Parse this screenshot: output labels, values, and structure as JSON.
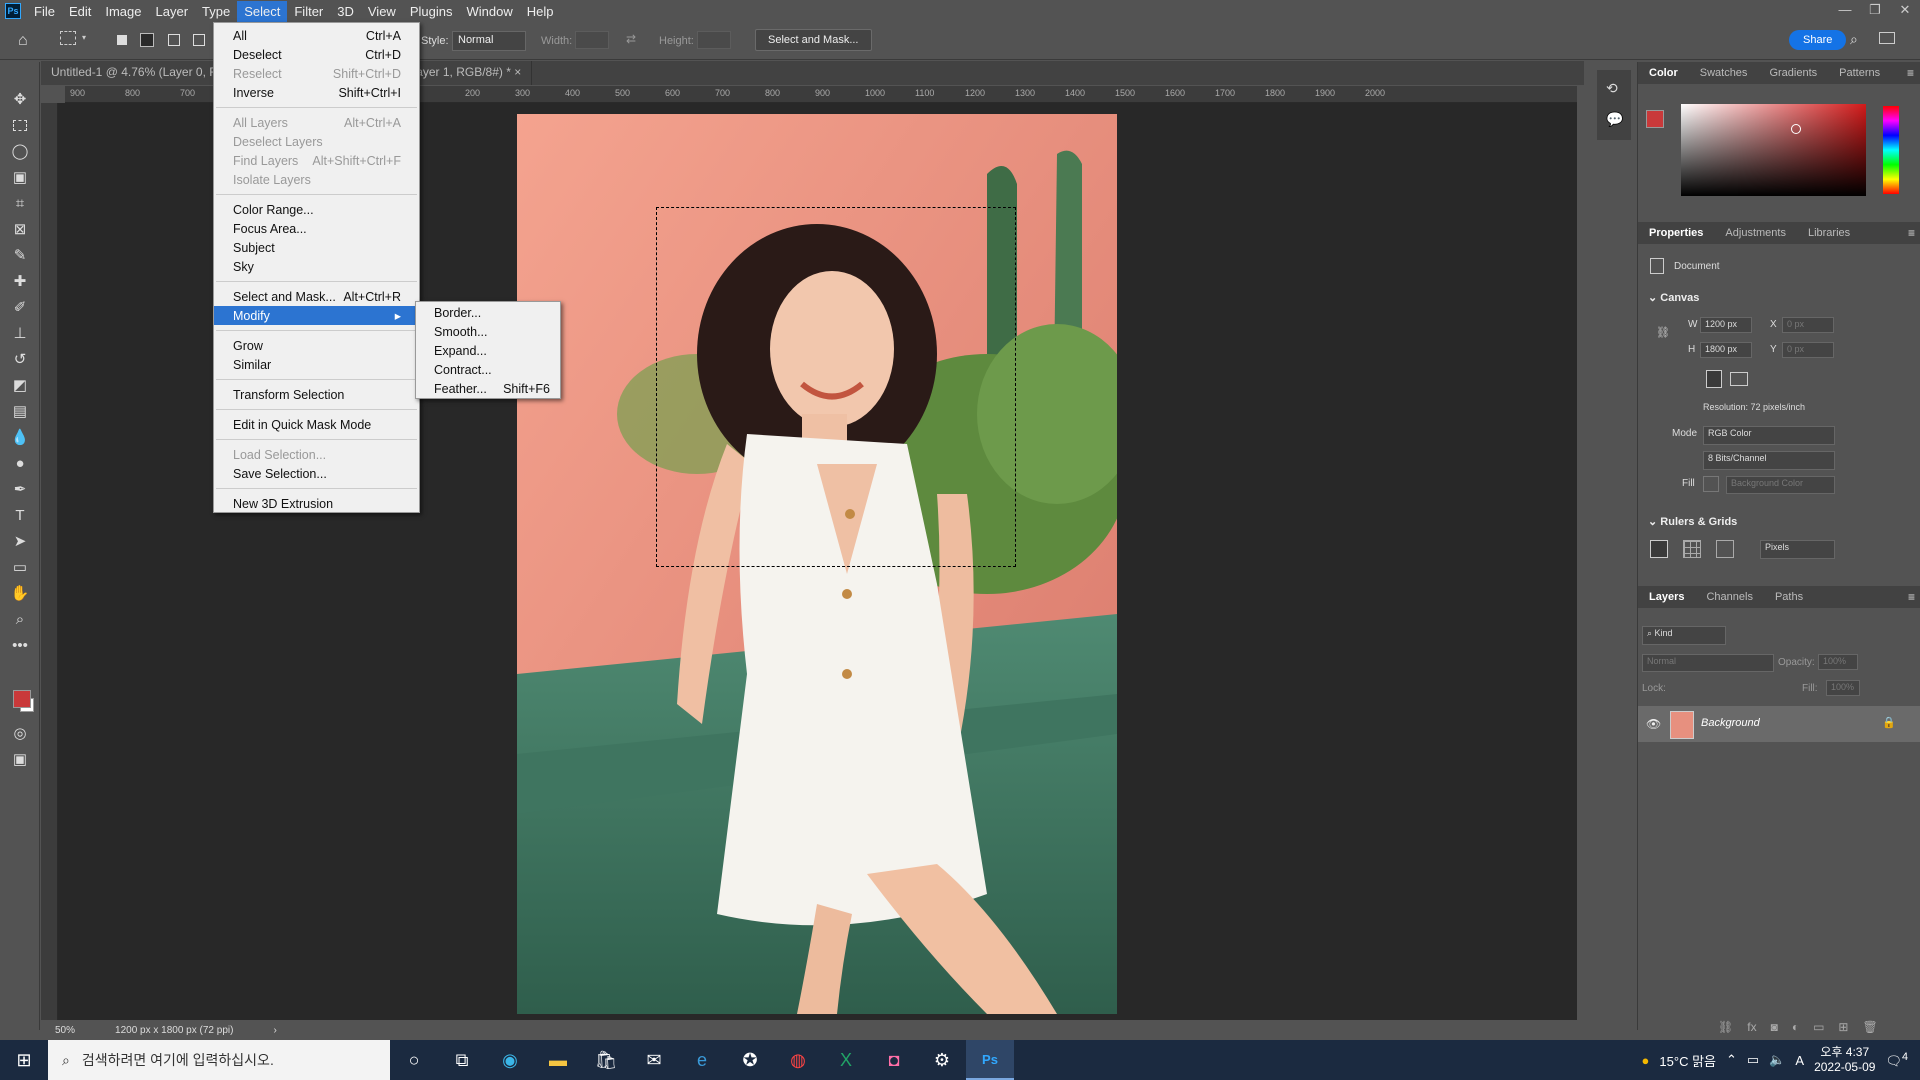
{
  "menubar": {
    "items": [
      "File",
      "Edit",
      "Image",
      "Layer",
      "Type",
      "Select",
      "Filter",
      "3D",
      "View",
      "Plugins",
      "Window",
      "Help"
    ],
    "active": "Select"
  },
  "options": {
    "style_label": "Style:",
    "style_value": "Normal",
    "width_label": "Width:",
    "height_label": "Height:",
    "select_mask_button": "Select and Mask...",
    "share_button": "Share"
  },
  "tabs": [
    {
      "label": "Untitled-1 @ 4.76% (Layer 0, R",
      "active": false
    },
    {
      "label": "/8#)",
      "active": true
    },
    {
      "label": "Untitled-2 @ 100% (Layer 1, RGB/8#) *",
      "active": false
    }
  ],
  "ruler": {
    "ticks": [
      "900",
      "800",
      "700",
      "200",
      "300",
      "400",
      "500",
      "600",
      "700",
      "800",
      "900",
      "1000",
      "1100",
      "1200",
      "1300",
      "1400",
      "1500",
      "1600",
      "1700",
      "1800",
      "1900",
      "2000"
    ]
  },
  "select_menu": {
    "groups": [
      [
        {
          "label": "All",
          "shortcut": "Ctrl+A",
          "disabled": false
        },
        {
          "label": "Deselect",
          "shortcut": "Ctrl+D",
          "disabled": false
        },
        {
          "label": "Reselect",
          "shortcut": "Shift+Ctrl+D",
          "disabled": true
        },
        {
          "label": "Inverse",
          "shortcut": "Shift+Ctrl+I",
          "disabled": false
        }
      ],
      [
        {
          "label": "All Layers",
          "shortcut": "Alt+Ctrl+A",
          "disabled": true
        },
        {
          "label": "Deselect Layers",
          "shortcut": "",
          "disabled": true
        },
        {
          "label": "Find Layers",
          "shortcut": "Alt+Shift+Ctrl+F",
          "disabled": true
        },
        {
          "label": "Isolate Layers",
          "shortcut": "",
          "disabled": true
        }
      ],
      [
        {
          "label": "Color Range...",
          "shortcut": "",
          "disabled": false
        },
        {
          "label": "Focus Area...",
          "shortcut": "",
          "disabled": false
        },
        {
          "label": "Subject",
          "shortcut": "",
          "disabled": false
        },
        {
          "label": "Sky",
          "shortcut": "",
          "disabled": false
        }
      ],
      [
        {
          "label": "Select and Mask...",
          "shortcut": "Alt+Ctrl+R",
          "disabled": false
        },
        {
          "label": "Modify",
          "shortcut": "",
          "disabled": false,
          "highlighted": true,
          "submenu": true
        }
      ],
      [
        {
          "label": "Grow",
          "shortcut": "",
          "disabled": false
        },
        {
          "label": "Similar",
          "shortcut": "",
          "disabled": false
        }
      ],
      [
        {
          "label": "Transform Selection",
          "shortcut": "",
          "disabled": false
        }
      ],
      [
        {
          "label": "Edit in Quick Mask Mode",
          "shortcut": "",
          "disabled": false
        }
      ],
      [
        {
          "label": "Load Selection...",
          "shortcut": "",
          "disabled": true
        },
        {
          "label": "Save Selection...",
          "shortcut": "",
          "disabled": false
        }
      ],
      [
        {
          "label": "New 3D Extrusion",
          "shortcut": "",
          "disabled": false
        }
      ]
    ]
  },
  "modify_submenu": [
    {
      "label": "Border...",
      "shortcut": ""
    },
    {
      "label": "Smooth...",
      "shortcut": ""
    },
    {
      "label": "Expand...",
      "shortcut": ""
    },
    {
      "label": "Contract...",
      "shortcut": ""
    },
    {
      "label": "Feather...",
      "shortcut": "Shift+F6"
    }
  ],
  "status": {
    "zoom": "50%",
    "doc_info": "1200 px x 1800 px (72 ppi)"
  },
  "color_panel": {
    "tabs": [
      "Color",
      "Swatches",
      "Gradients",
      "Patterns"
    ],
    "active": "Color",
    "foreground": "#c9393a",
    "background": "#ffffff"
  },
  "properties_panel": {
    "tabs": [
      "Properties",
      "Adjustments",
      "Libraries"
    ],
    "active": "Properties",
    "doc_label": "Document",
    "canvas_heading": "Canvas",
    "w_label": "W",
    "w_value": "1200 px",
    "h_label": "H",
    "h_value": "1800 px",
    "x_label": "X",
    "x_value": "0 px",
    "y_label": "Y",
    "y_value": "0 px",
    "resolution": "Resolution: 72 pixels/inch",
    "mode_label": "Mode",
    "mode_value": "RGB Color",
    "bits_value": "8 Bits/Channel",
    "fill_label": "Fill",
    "fill_value": "Background Color",
    "rulers_heading": "Rulers & Grids",
    "units_value": "Pixels"
  },
  "layers_panel": {
    "tabs": [
      "Layers",
      "Channels",
      "Paths"
    ],
    "active": "Layers",
    "kind_placeholder": "Kind",
    "blend_mode": "Normal",
    "opacity_label": "Opacity:",
    "opacity_value": "100%",
    "lock_label": "Lock:",
    "fill_label": "Fill:",
    "fill_value": "100%",
    "layers": [
      {
        "name": "Background",
        "visible": true,
        "locked": true
      }
    ]
  },
  "taskbar": {
    "search_placeholder": "검색하려면 여기에 입력하십시오.",
    "weather": "15°C 맑음",
    "time": "오후 4:37",
    "date": "2022-05-09",
    "notifications": "4",
    "ime": "A"
  }
}
